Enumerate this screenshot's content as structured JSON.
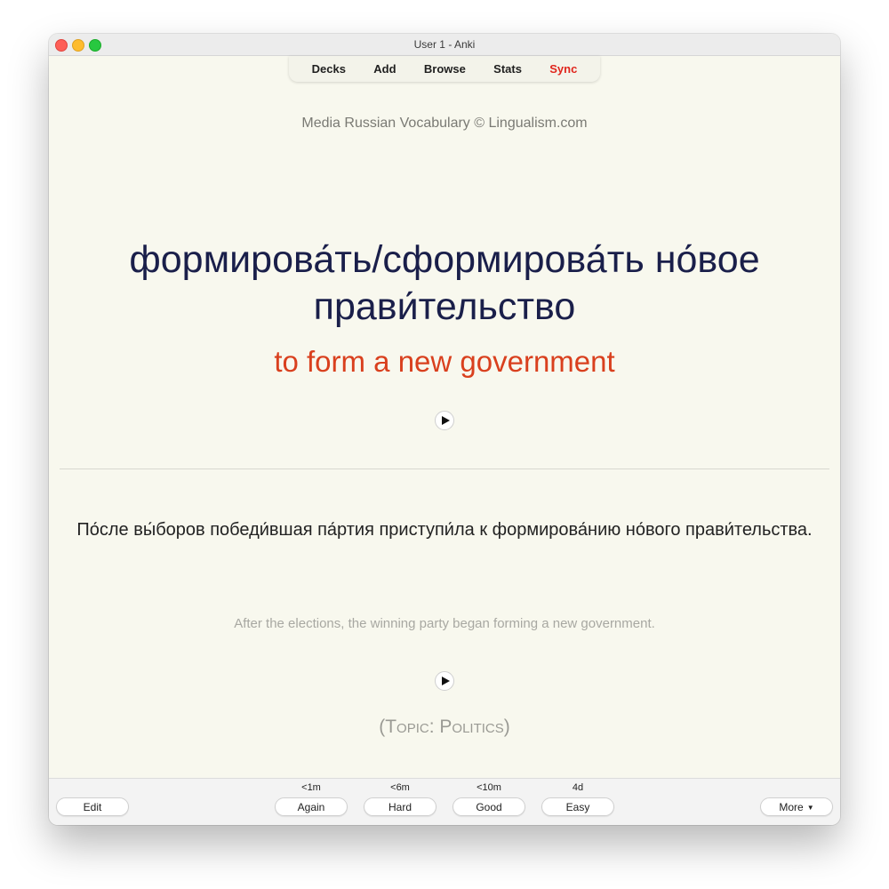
{
  "window": {
    "title": "User 1 - Anki"
  },
  "toolbar": {
    "decks": "Decks",
    "add": "Add",
    "browse": "Browse",
    "stats": "Stats",
    "sync": "Sync"
  },
  "card": {
    "deck_credit": "Media Russian Vocabulary © Lingualism.com",
    "front": "формирова́ть/сформирова́ть но́вое прави́тельство",
    "translation": "to form a new government",
    "play_icon": "play-icon",
    "sentence_ru": "По́сле вы́боров победи́вшая па́ртия приступи́ла к формирова́нию но́вого прави́тельства.",
    "sentence_en": "After the elections, the winning party began forming a new government.",
    "topic": "(Topic: Politics)"
  },
  "answer_bar": {
    "edit": "Edit",
    "more": "More",
    "again": {
      "label": "Again",
      "interval": "<1m"
    },
    "hard": {
      "label": "Hard",
      "interval": "<6m"
    },
    "good": {
      "label": "Good",
      "interval": "<10m"
    },
    "easy": {
      "label": "Easy",
      "interval": "4d"
    }
  },
  "colors": {
    "card_background": "#f8f8ee",
    "front_text": "#1a1f4a",
    "translation_text": "#d9401e",
    "sync_accent": "#e0261d"
  }
}
